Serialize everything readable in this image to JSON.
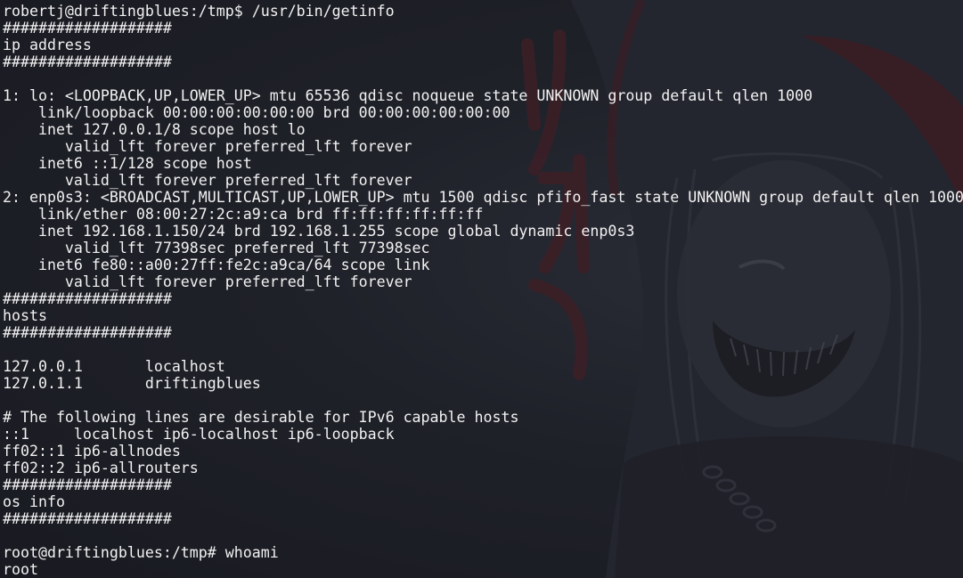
{
  "terminal": {
    "lines": [
      "robertj@driftingblues:/tmp$ /usr/bin/getinfo",
      "###################",
      "ip address",
      "###################",
      "",
      "1: lo: <LOOPBACK,UP,LOWER_UP> mtu 65536 qdisc noqueue state UNKNOWN group default qlen 1000",
      "    link/loopback 00:00:00:00:00:00 brd 00:00:00:00:00:00",
      "    inet 127.0.0.1/8 scope host lo",
      "       valid_lft forever preferred_lft forever",
      "    inet6 ::1/128 scope host",
      "       valid_lft forever preferred_lft forever",
      "2: enp0s3: <BROADCAST,MULTICAST,UP,LOWER_UP> mtu 1500 qdisc pfifo_fast state UNKNOWN group default qlen 1000",
      "    link/ether 08:00:27:2c:a9:ca brd ff:ff:ff:ff:ff:ff",
      "    inet 192.168.1.150/24 brd 192.168.1.255 scope global dynamic enp0s3",
      "       valid_lft 77398sec preferred_lft 77398sec",
      "    inet6 fe80::a00:27ff:fe2c:a9ca/64 scope link",
      "       valid_lft forever preferred_lft forever",
      "###################",
      "hosts",
      "###################",
      "",
      "127.0.0.1       localhost",
      "127.0.1.1       driftingblues",
      "",
      "# The following lines are desirable for IPv6 capable hosts",
      "::1     localhost ip6-localhost ip6-loopback",
      "ff02::1 ip6-allnodes",
      "ff02::2 ip6-allrouters",
      "###################",
      "os info",
      "###################",
      "",
      "root@driftingblues:/tmp# whoami",
      "root"
    ]
  },
  "colors": {
    "background": "#1b1d26",
    "foreground": "#f2f2f2",
    "wallpaper_accent": "#5a2a30"
  }
}
